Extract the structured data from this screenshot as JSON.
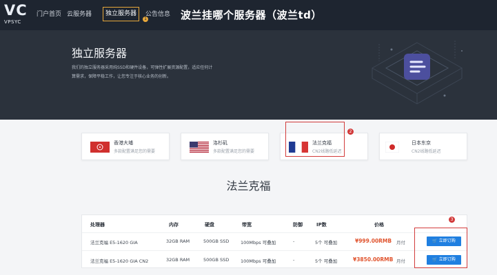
{
  "nav": {
    "logo_text": "VC",
    "logo_sub": "VPSYC",
    "items": [
      {
        "label": "门户首页",
        "active": false
      },
      {
        "label": "云服务器",
        "active": false
      },
      {
        "label": "独立服务器",
        "active": true
      },
      {
        "label": "公告信息",
        "active": false
      }
    ],
    "active_marker": "1"
  },
  "overlay_title": "波兰挂哪个服务器（波兰td）",
  "hero": {
    "title": "独立服务器",
    "description": "我们的独立服务器采用纯SSD和硬件设备，可弹性扩展资源配置，适应任何计算需求，保障平稳工作，让您专注于核心业务的创新。"
  },
  "locations": [
    {
      "name": "香港大埔",
      "sub": "多款配置满足您的需要",
      "flag": "hong-kong-flag"
    },
    {
      "name": "洛杉矶",
      "sub": "多款配置满足您的需要",
      "flag": "usa-flag"
    },
    {
      "name": "法兰克福",
      "sub": "CN2线路低延迟",
      "flag": "france-flag"
    },
    {
      "name": "日本东京",
      "sub": "CN2线路低延迟",
      "flag": "japan-flag"
    }
  ],
  "location_marker": "2",
  "section_title": "法兰克福",
  "table": {
    "headers": [
      "处理器",
      "内存",
      "硬盘",
      "带宽",
      "防御",
      "IP数",
      "价格"
    ],
    "rows": [
      {
        "cpu": "法兰克福 E5-1620 GIA",
        "ram": "32GB RAM",
        "disk": "500GB SSD",
        "bandwidth": "100Mbps 可叠加",
        "defense": "-",
        "ip": "5个 可叠加",
        "price": "¥999.00RMB",
        "unit": "月付",
        "button": "立即订购"
      },
      {
        "cpu": "法兰克福 E5-1620 GIA CN2",
        "ram": "32GB RAM",
        "disk": "500GB SSD",
        "bandwidth": "100Mbps 可叠加",
        "defense": "-",
        "ip": "5个 可叠加",
        "price": "¥3850.00RMB",
        "unit": "月付",
        "button": "立即订购"
      }
    ]
  },
  "order_marker": "3",
  "colors": {
    "nav_bg": "#1e2530",
    "hero_bg": "#2b323c",
    "accent": "#e8a83b",
    "highlight": "#d23a3a",
    "price": "#e0532d",
    "button": "#1f7fe0"
  }
}
